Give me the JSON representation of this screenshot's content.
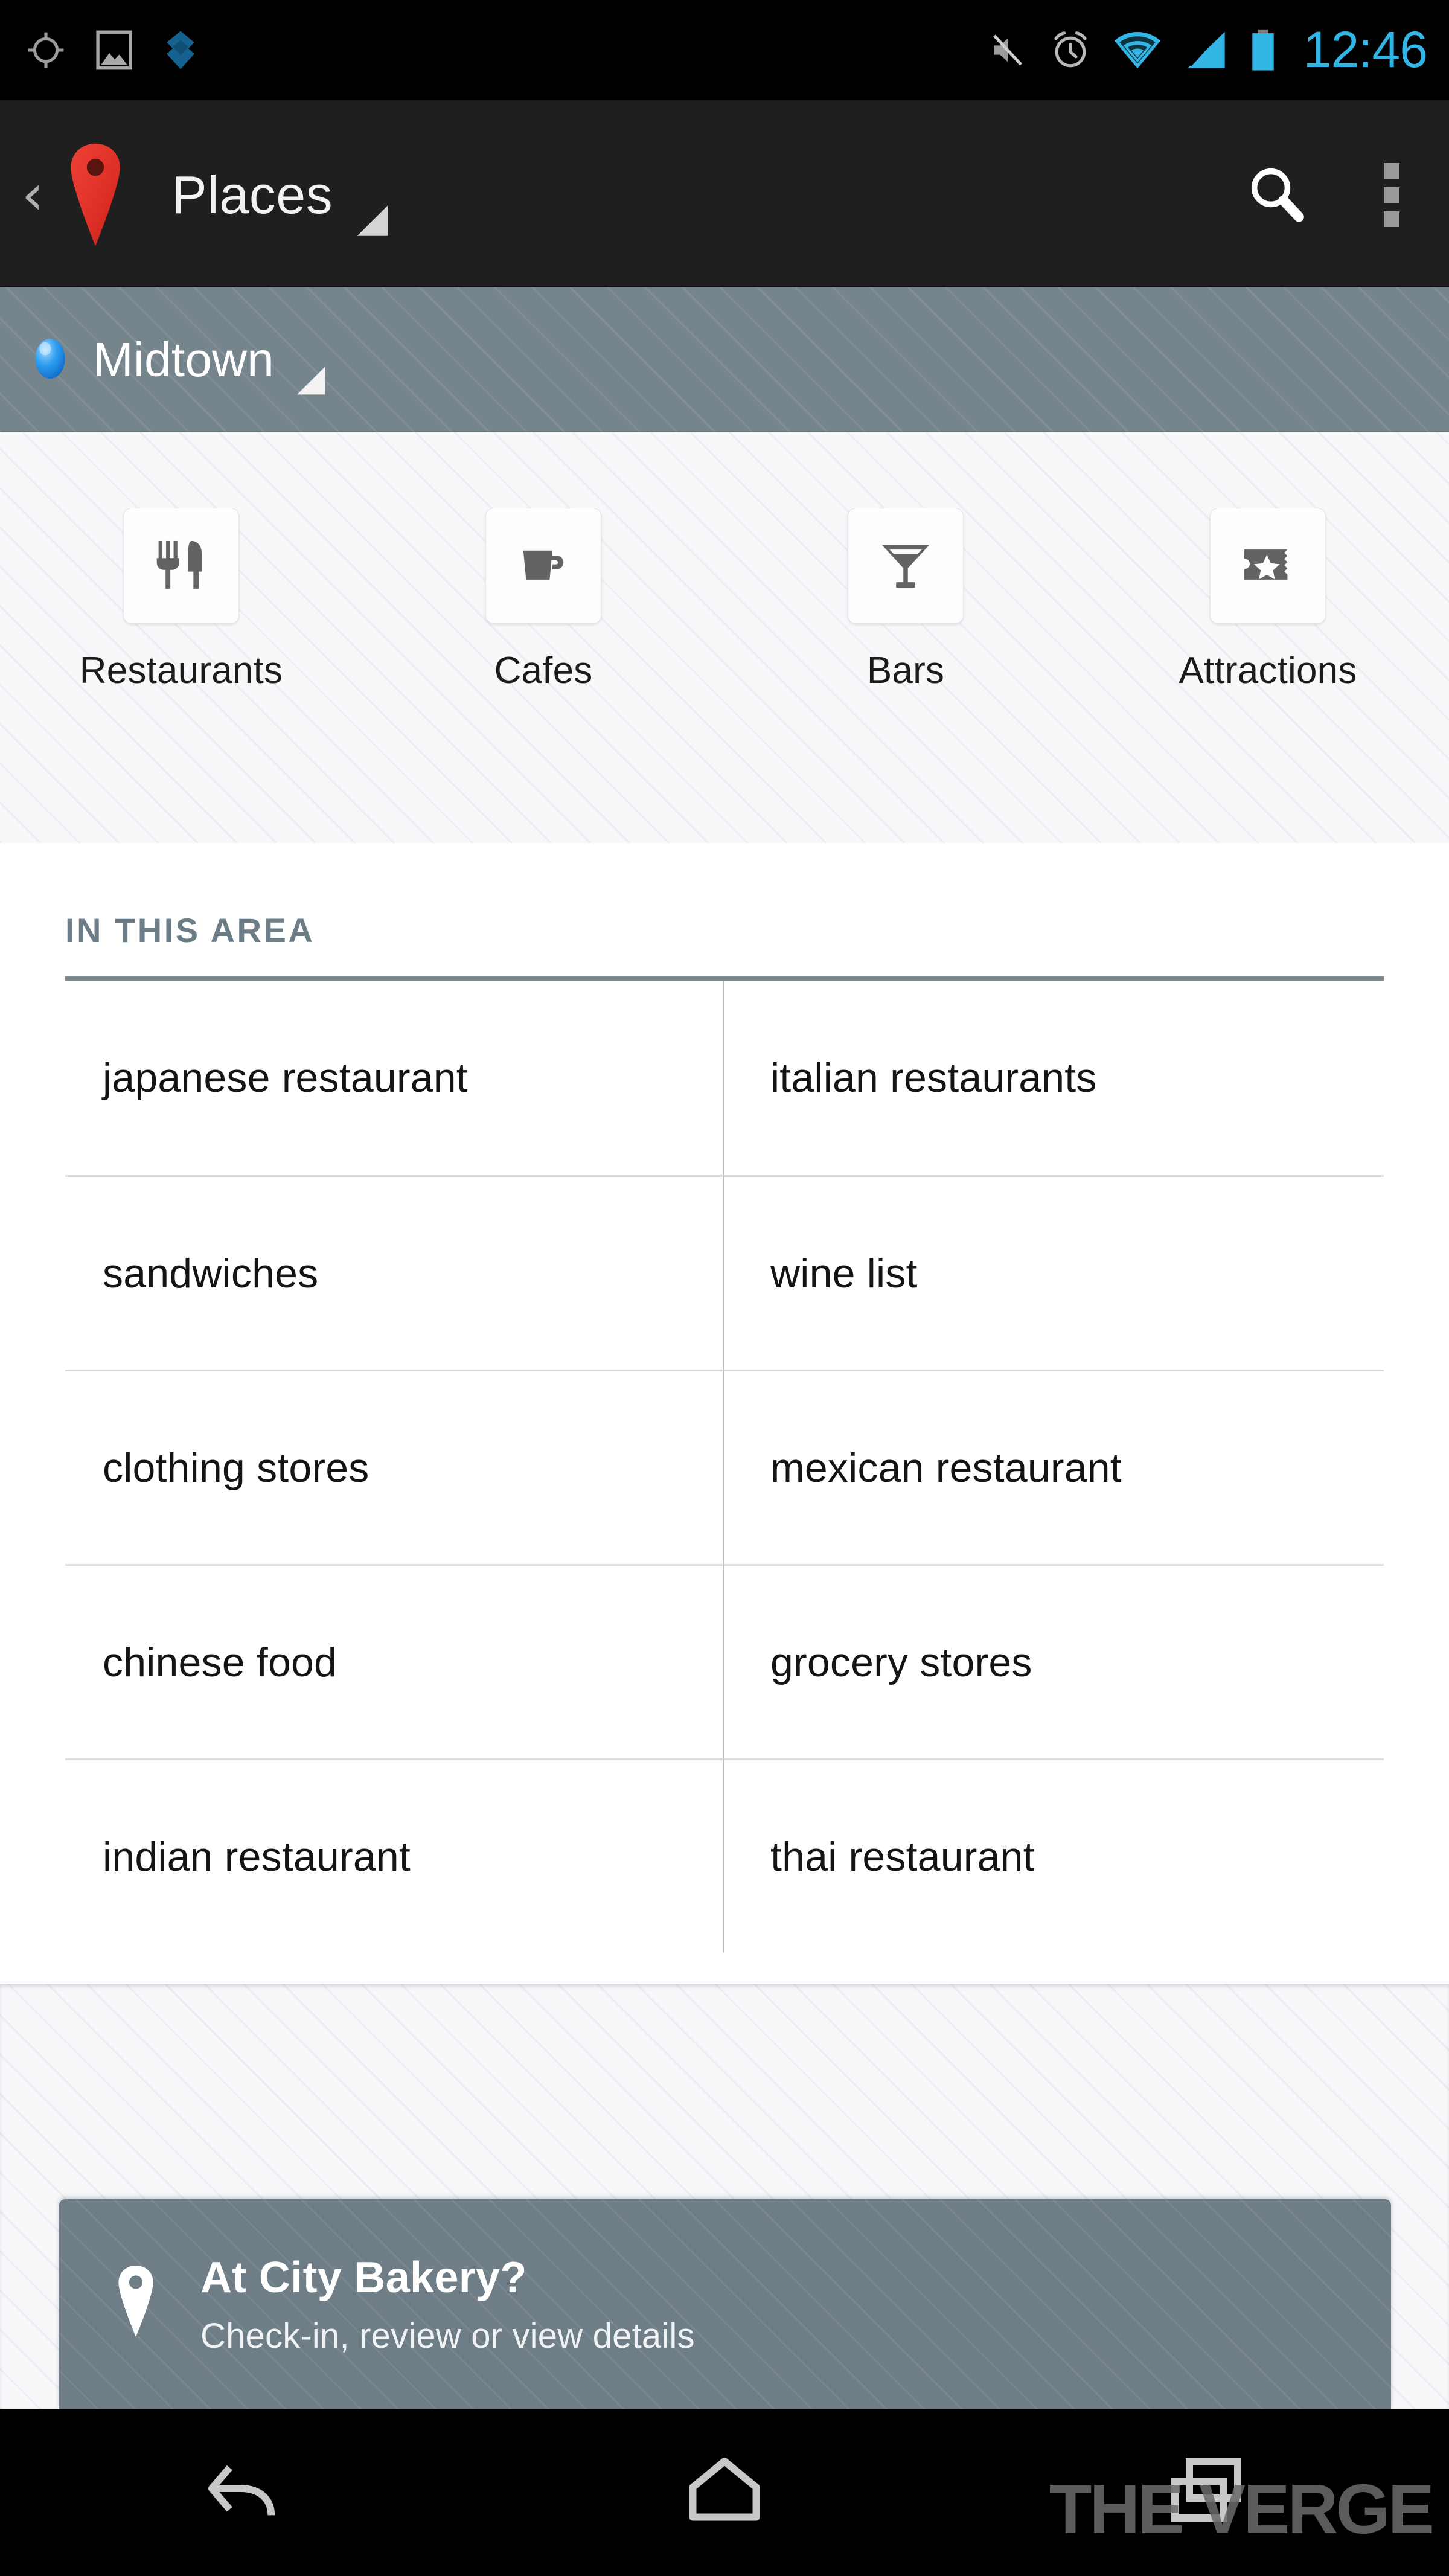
{
  "statusbar": {
    "time": "12:46",
    "left_icons": [
      "gps-crosshair-icon",
      "photo-icon",
      "evernote-icon"
    ],
    "right_icons": [
      "volume-muted-icon",
      "alarm-clock-icon",
      "wifi-icon",
      "cellular-signal-icon",
      "battery-icon"
    ],
    "accent_color": "#33b5e5"
  },
  "actionbar": {
    "back_label": "‹",
    "app_icon": "map-pin-icon",
    "title": "Places",
    "spinner_icon": "dropdown-spinner-icon",
    "search_icon": "search-icon",
    "overflow_icon": "overflow-menu-icon",
    "background_color": "#1f1f1f"
  },
  "location_bar": {
    "dot_icon": "location-dot-icon",
    "name": "Midtown",
    "spinner_icon": "dropdown-spinner-icon",
    "background_color": "#76848c"
  },
  "categories": [
    {
      "label": "Restaurants",
      "icon": "fork-knife-icon"
    },
    {
      "label": "Cafes",
      "icon": "coffee-cup-icon"
    },
    {
      "label": "Bars",
      "icon": "martini-glass-icon"
    },
    {
      "label": "Attractions",
      "icon": "ticket-star-icon"
    }
  ],
  "suggestions": {
    "section_title": "IN THIS AREA",
    "rows": [
      {
        "left": "japanese restaurant",
        "right": "italian restaurants"
      },
      {
        "left": "sandwiches",
        "right": "wine list"
      },
      {
        "left": "clothing stores",
        "right": "mexican restaurant"
      },
      {
        "left": "chinese food",
        "right": "grocery stores"
      },
      {
        "left": "indian restaurant",
        "right": "thai restaurant"
      }
    ]
  },
  "checkin_card": {
    "pin_icon": "map-pin-outline-icon",
    "title": "At City Bakery?",
    "subtitle": "Check-in, review or view details",
    "background_color": "#6e7d86"
  },
  "navbar": {
    "back_icon": "nav-back-icon",
    "home_icon": "nav-home-icon",
    "recents_icon": "nav-recents-icon",
    "watermark": "THE VERGE"
  }
}
